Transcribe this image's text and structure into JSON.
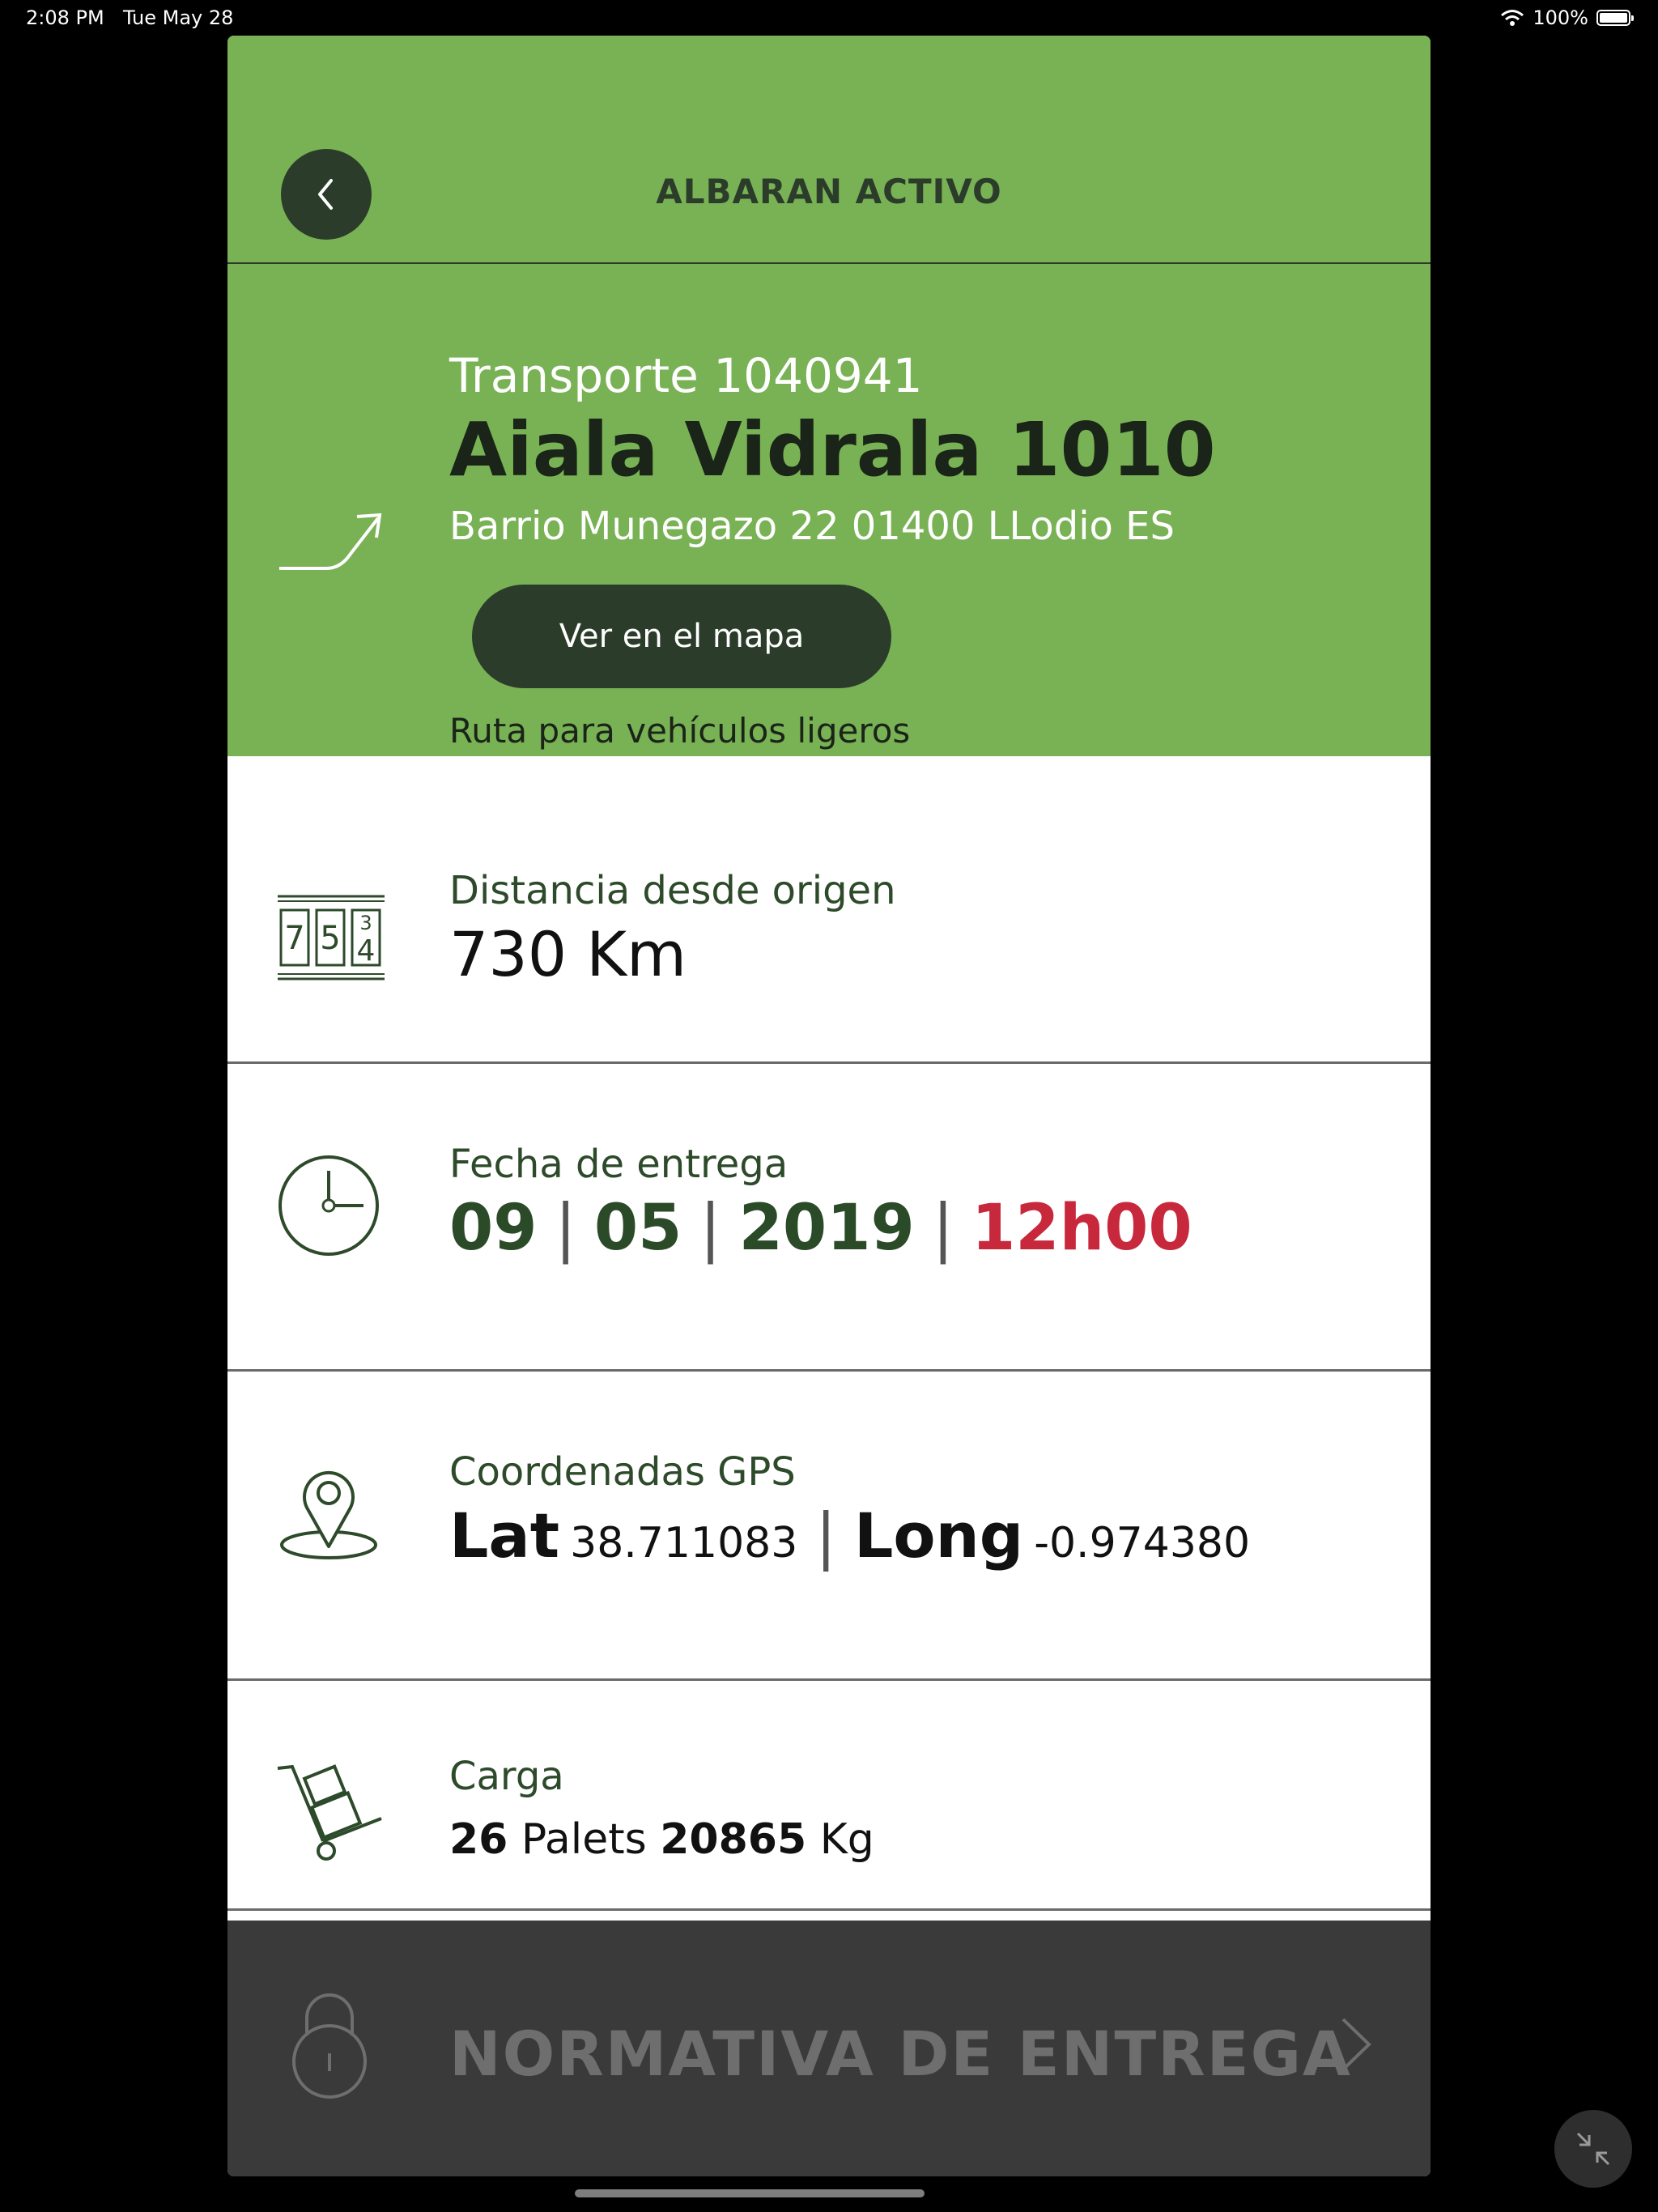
{
  "status_bar": {
    "time": "2:08 PM",
    "date": "Tue May 28",
    "battery": "100%",
    "battery_level": 1.0
  },
  "header": {
    "title": "ALBARAN ACTIVO"
  },
  "transport": {
    "number": "Transporte 1040941",
    "name": "Aiala Vidrala 1010",
    "address": "Barrio Munegazo 22 01400 LLodio ES",
    "map_button": "Ver en el mapa",
    "route_type": "Ruta para vehículos ligeros"
  },
  "distance": {
    "label": "Distancia desde origen",
    "value": "730 Km",
    "icon_digits": [
      "7",
      "5",
      "3",
      "4"
    ]
  },
  "delivery": {
    "label": "Fecha de entrega",
    "day": "09",
    "month": "05",
    "year": "2019",
    "time": "12h00",
    "separator": "|"
  },
  "gps": {
    "label": "Coordenadas GPS",
    "lat_label": "Lat",
    "lat": "38.711083",
    "long_label": "Long",
    "long": "-0.974380"
  },
  "load": {
    "label": "Carga",
    "pallets": "26",
    "pallets_unit": "Palets",
    "weight": "20865",
    "weight_unit": "Kg"
  },
  "footer": {
    "label": "NORMATIVA DE ENTREGA"
  },
  "colors": {
    "green": "#79b255",
    "dark_green": "#2b3c2b",
    "red": "#c8283b",
    "footer_bg": "#3a3a3a"
  }
}
